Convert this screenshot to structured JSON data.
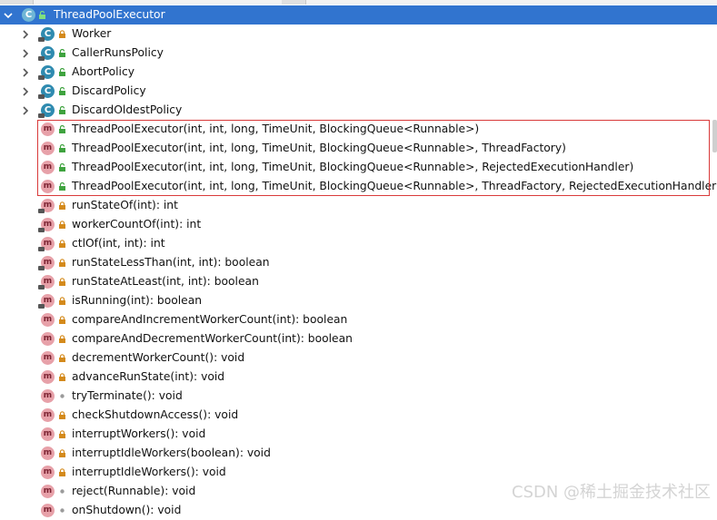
{
  "root": {
    "label": "ThreadPoolExecutor"
  },
  "inner_classes": [
    {
      "label": "Worker",
      "icon": "class-icon",
      "visibility": "private"
    },
    {
      "label": "CallerRunsPolicy",
      "icon": "class-icon",
      "visibility": "public"
    },
    {
      "label": "AbortPolicy",
      "icon": "class-icon",
      "visibility": "public"
    },
    {
      "label": "DiscardPolicy",
      "icon": "class-icon",
      "visibility": "public"
    },
    {
      "label": "DiscardOldestPolicy",
      "icon": "class-icon",
      "visibility": "public"
    }
  ],
  "constructors": [
    {
      "label": "ThreadPoolExecutor(int, int, long, TimeUnit, BlockingQueue<Runnable>)",
      "visibility": "public"
    },
    {
      "label": "ThreadPoolExecutor(int, int, long, TimeUnit, BlockingQueue<Runnable>, ThreadFactory)",
      "visibility": "public"
    },
    {
      "label": "ThreadPoolExecutor(int, int, long, TimeUnit, BlockingQueue<Runnable>, RejectedExecutionHandler)",
      "visibility": "public"
    },
    {
      "label": "ThreadPoolExecutor(int, int, long, TimeUnit, BlockingQueue<Runnable>, ThreadFactory, RejectedExecutionHandler)",
      "visibility": "public"
    }
  ],
  "methods": [
    {
      "label": "runStateOf(int): int",
      "visibility": "private",
      "static": true
    },
    {
      "label": "workerCountOf(int): int",
      "visibility": "private",
      "static": true
    },
    {
      "label": "ctlOf(int, int): int",
      "visibility": "private",
      "static": true
    },
    {
      "label": "runStateLessThan(int, int): boolean",
      "visibility": "private",
      "static": true
    },
    {
      "label": "runStateAtLeast(int, int): boolean",
      "visibility": "private",
      "static": true
    },
    {
      "label": "isRunning(int): boolean",
      "visibility": "private",
      "static": true
    },
    {
      "label": "compareAndIncrementWorkerCount(int): boolean",
      "visibility": "private",
      "static": false
    },
    {
      "label": "compareAndDecrementWorkerCount(int): boolean",
      "visibility": "private",
      "static": false
    },
    {
      "label": "decrementWorkerCount(): void",
      "visibility": "private",
      "static": false
    },
    {
      "label": "advanceRunState(int): void",
      "visibility": "private",
      "static": false
    },
    {
      "label": "tryTerminate(): void",
      "visibility": "package",
      "static": false
    },
    {
      "label": "checkShutdownAccess(): void",
      "visibility": "private",
      "static": false
    },
    {
      "label": "interruptWorkers(): void",
      "visibility": "private",
      "static": false
    },
    {
      "label": "interruptIdleWorkers(boolean): void",
      "visibility": "private",
      "static": false
    },
    {
      "label": "interruptIdleWorkers(): void",
      "visibility": "private",
      "static": false
    },
    {
      "label": "reject(Runnable): void",
      "visibility": "package",
      "static": false
    },
    {
      "label": "onShutdown(): void",
      "visibility": "package",
      "static": false
    }
  ],
  "watermark": "CSDN @稀土掘金技术社区",
  "colors": {
    "selection": "#3174cf",
    "highlight_box": "#d93a3a",
    "class_icon": "#2f8bb0",
    "method_icon": "#e7a1a9",
    "public": "#3fa33f",
    "private": "#d48a1c"
  }
}
